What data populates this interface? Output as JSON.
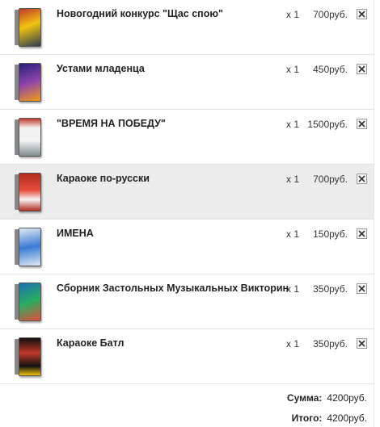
{
  "items": [
    {
      "title": "Новогодний конкурс \"Щас спою\"",
      "qty": "x 1",
      "price": "700руб.",
      "thumb": "cover-icon",
      "cover_colors": [
        "#c0392b",
        "#f1c40f",
        "#2c3e50"
      ]
    },
    {
      "title": "Устами младенца",
      "qty": "x 1",
      "price": "450руб.",
      "thumb": "cover-icon",
      "cover_colors": [
        "#2a1f7a",
        "#8e44ad",
        "#f39c12"
      ]
    },
    {
      "title": "\"ВРЕМЯ НА ПОБЕДУ\"",
      "qty": "x 1",
      "price": "1500руб.",
      "thumb": "cover-icon",
      "cover_colors": [
        "#f2f2f2",
        "#c0392b",
        "#7f8c8d"
      ]
    },
    {
      "title": "Караоке по-русски",
      "qty": "x 1",
      "price": "700руб.",
      "thumb": "cover-icon",
      "cover_colors": [
        "#b22d1e",
        "#e74c3c",
        "#f5f5f5"
      ]
    },
    {
      "title": "ИМЕНА",
      "qty": "x 1",
      "price": "150руб.",
      "thumb": "cover-icon",
      "cover_colors": [
        "#dfe8f2",
        "#3a7bd5",
        "#c0392b"
      ]
    },
    {
      "title": "Сборник Застольных Музыкальных Викторин",
      "qty": "x 1",
      "price": "350руб.",
      "thumb": "cover-icon",
      "cover_colors": [
        "#1f6fb2",
        "#27ae60",
        "#e74c3c"
      ]
    },
    {
      "title": "Караоке Батл",
      "qty": "x 1",
      "price": "350руб.",
      "thumb": "cover-icon",
      "cover_colors": [
        "#111111",
        "#c0392b",
        "#f1c40f"
      ]
    }
  ],
  "totals": {
    "sum_label": "Сумма:",
    "sum_value": "4200руб.",
    "total_label": "Итого:",
    "total_value": "4200руб."
  },
  "highlight_row": 3
}
